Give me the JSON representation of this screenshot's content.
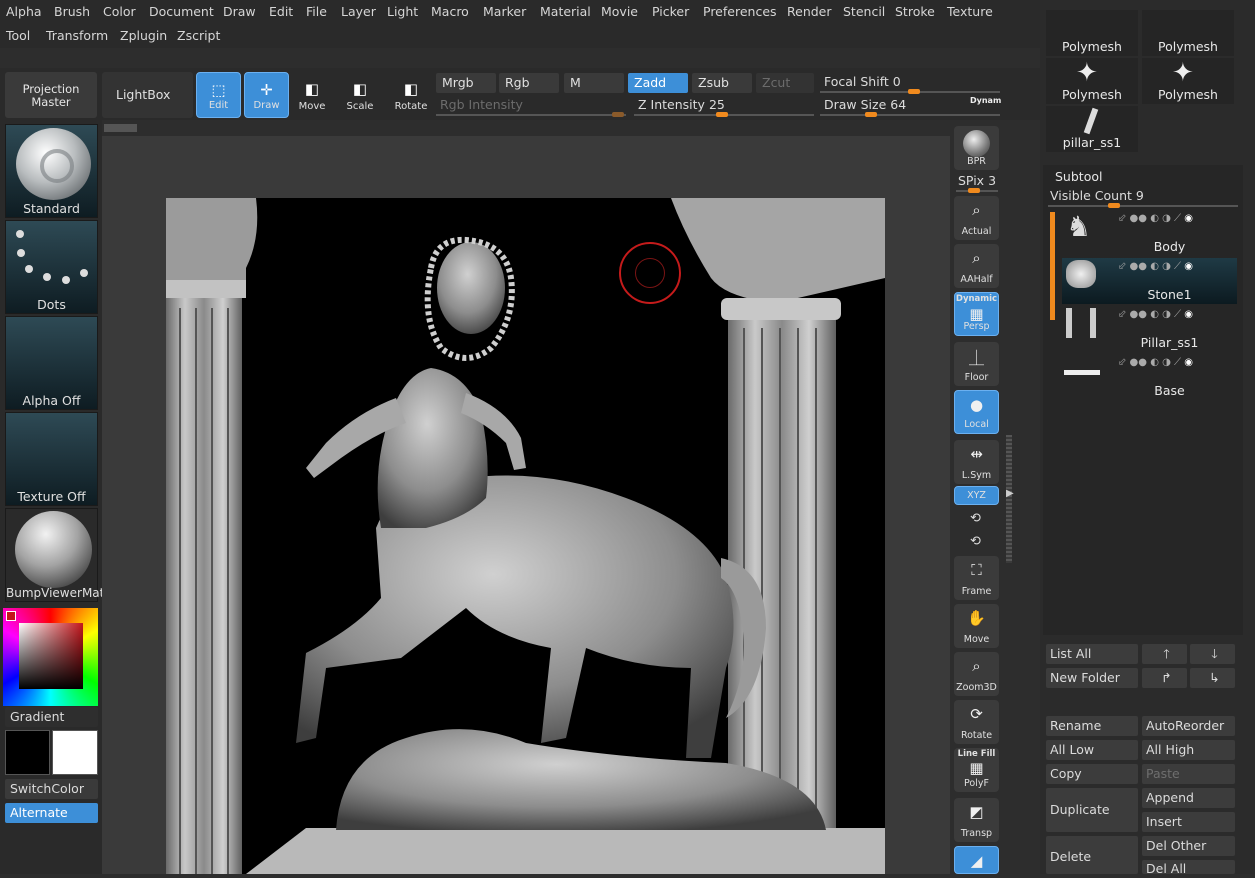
{
  "menu": {
    "row1": [
      "Alpha",
      "Brush",
      "Color",
      "Document",
      "Draw",
      "Edit",
      "File",
      "Layer",
      "Light",
      "Macro",
      "Marker",
      "Material",
      "Movie",
      "Picker",
      "Preferences",
      "Render",
      "Stencil",
      "Stroke",
      "Texture"
    ],
    "row2": [
      "Tool",
      "Transform",
      "Zplugin",
      "Zscript"
    ]
  },
  "toolbar": {
    "projection_master": "Projection Master",
    "lightbox": "LightBox",
    "edit": "Edit",
    "draw": "Draw",
    "move": "Move",
    "scale": "Scale",
    "rotate": "Rotate",
    "mrgb": "Mrgb",
    "rgb": "Rgb",
    "m": "M",
    "zadd": "Zadd",
    "zsub": "Zsub",
    "zcut": "Zcut",
    "rgb_intensity": "Rgb Intensity",
    "z_intensity_label": "Z Intensity",
    "z_intensity": "25",
    "focal_shift_label": "Focal Shift",
    "focal_shift": "0",
    "draw_size_label": "Draw Size",
    "draw_size": "64",
    "dynamic": "Dynam"
  },
  "shelf": {
    "brush": "Standard",
    "stroke": "Dots",
    "alpha": "Alpha Off",
    "texture": "Texture Off",
    "material": "BumpViewerMat",
    "gradient": "Gradient",
    "switch_color": "SwitchColor",
    "alternate": "Alternate"
  },
  "strip": {
    "bpr": "BPR",
    "spix_label": "SPix",
    "spix": "3",
    "actual": "Actual",
    "aahalf": "AAHalf",
    "dynamic": "Dynamic",
    "persp": "Persp",
    "floor": "Floor",
    "local": "Local",
    "lsym": "L.Sym",
    "xyz": "XYZ",
    "frame": "Frame",
    "move": "Move",
    "zoom3d": "Zoom3D",
    "rotate": "Rotate",
    "linefill": "Line Fill",
    "polyf": "PolyF",
    "transp": "Transp"
  },
  "tools": [
    "Polymesh",
    "Polymesh",
    "Polymesh",
    "Polymesh",
    "pillar_ss1"
  ],
  "subtool": {
    "title": "Subtool",
    "visible_count_label": "Visible Count",
    "visible_count": "9",
    "items": [
      "Body",
      "Stone1",
      "Pillar_ss1",
      "Base"
    ]
  },
  "actions": {
    "list_all": "List All",
    "new_folder": "New Folder",
    "rename": "Rename",
    "autoreorder": "AutoReorder",
    "all_low": "All Low",
    "all_high": "All High",
    "copy": "Copy",
    "paste": "Paste",
    "duplicate": "Duplicate",
    "append": "Append",
    "insert": "Insert",
    "delete": "Delete",
    "del_other": "Del Other",
    "del_all": "Del All"
  },
  "colors": {
    "accent": "#3d8fd8",
    "orange": "#f08a1e"
  }
}
